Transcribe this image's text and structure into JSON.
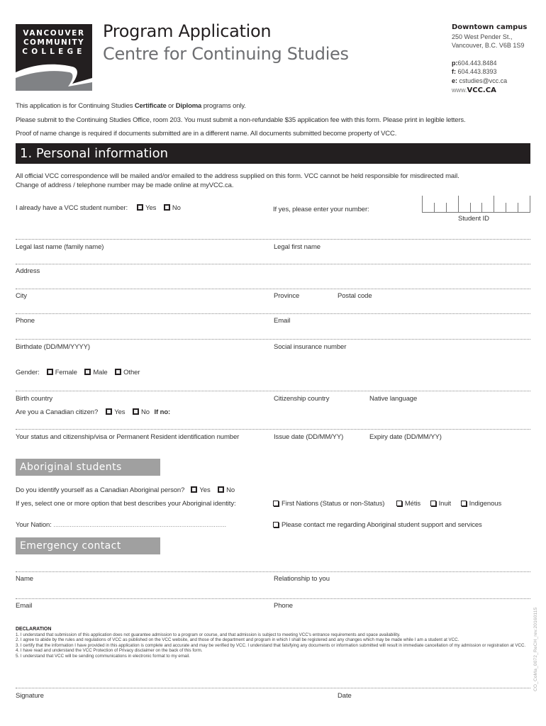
{
  "header": {
    "logo_lines": [
      "VANCOUVER",
      "COMMUNITY",
      "COLLEGE"
    ],
    "title": "Program Application",
    "subtitle": "Centre for Continuing Studies"
  },
  "contact": {
    "campus": "Downtown campus",
    "address_line1": "250 West Pender St.,",
    "address_line2": "Vancouver, B.C. V6B 1S9",
    "phone_label": "p:",
    "phone": "604.443.8484",
    "fax_label": "f:",
    "fax": " 604.443.8393",
    "email_label": "e:",
    "email": " cstudies@vcc.ca",
    "web_prefix": "www.",
    "web_domain": "VCC.CA"
  },
  "intro": {
    "line1_prefix": "This application is for Continuing Studies ",
    "line1_bold1": "Certificate",
    "line1_mid": " or ",
    "line1_bold2": "Diploma",
    "line1_suffix": " programs only.",
    "line2": "Please submit to the Continuing Studies Office, room 203. You must submit a non-refundable $35 application fee with this form. Please print in legible letters.",
    "line3": "Proof of name change is required if documents submitted are in a different name. All documents submitted become property of VCC."
  },
  "personal": {
    "heading": "1. Personal information",
    "notice_line1": "All official VCC correspondence will be mailed and/or emailed to the address supplied on this form. VCC cannot be held responsible for misdirected mail.",
    "notice_line2": "Change of address / telephone number may be made online at myVCC.ca.",
    "student_number_question": "I already have a VCC student number:",
    "yes": "Yes",
    "no": "No",
    "enter_number_prompt": "If yes, please enter your number:",
    "student_id_label": "Student ID",
    "student_id_digits": 9,
    "fields": {
      "last_name": "Legal last name (family name)",
      "first_name": "Legal first name",
      "address": "Address",
      "city": "City",
      "province": "Province",
      "postal_code": "Postal code",
      "phone": "Phone",
      "email": "Email",
      "birthdate": "Birthdate (DD/MM/YYYY)",
      "sin": "Social insurance number",
      "birth_country": "Birth country",
      "citizenship_country": "Citizenship country",
      "native_language": "Native language",
      "status_id": "Your status and citizenship/visa or Permanent Resident identification number",
      "issue_date": "Issue date (DD/MM/YY)",
      "expiry_date": "Expiry date (DD/MM/YY)"
    },
    "gender_label": "Gender:",
    "gender_options": [
      "Female",
      "Male",
      "Other"
    ],
    "citizen_question": "Are you a Canadian citizen?",
    "if_no": "If no:"
  },
  "aboriginal": {
    "heading": "Aboriginal students",
    "identify_question": "Do you identify yourself as a Canadian Aboriginal person?",
    "yes": "Yes",
    "no": "No",
    "identity_prompt": "If yes, select one or more option that best describes your Aboriginal identity:",
    "identity_options": [
      "First Nations (Status or non-Status)",
      "Métis",
      "Inuit",
      "Indigenous"
    ],
    "nation_label": "Your Nation:",
    "nation_dots": "................................................................................................",
    "contact_me": "Please contact me regarding Aboriginal student support and services"
  },
  "emergency": {
    "heading": "Emergency contact",
    "name": "Name",
    "relationship": "Relationship to you",
    "email": "Email",
    "phone": "Phone"
  },
  "declaration": {
    "heading": "DECLARATION",
    "items": [
      "1.  I understand that submission of this application does not guarantee admission to a program or course, and that admission is subject to meeting VCC's entrance requirements and space availability.",
      "2.  I agree to abide by the rules and regulations of VCC as published on the VCC website, and those of the department and program in which I shall be registered and any changes which may be made while I am a student at VCC.",
      "3.  I certify that the information I have provided in this application is complete and accurate and may be verified by VCC. I understand that falsifying any documents or information submitted will result in immediate cancellation of my admission or registration at VCC.",
      "4. I have read and understand the VCC Protection of Privacy disclaimer on the back of this form.",
      "5. I understand that VCC will be sending communications in electronic format to my email."
    ]
  },
  "signature": {
    "signature_label": "Signature",
    "date_label": "Date"
  },
  "form_code": "CO_CoMa_0072_ReCH_rev.20160115"
}
